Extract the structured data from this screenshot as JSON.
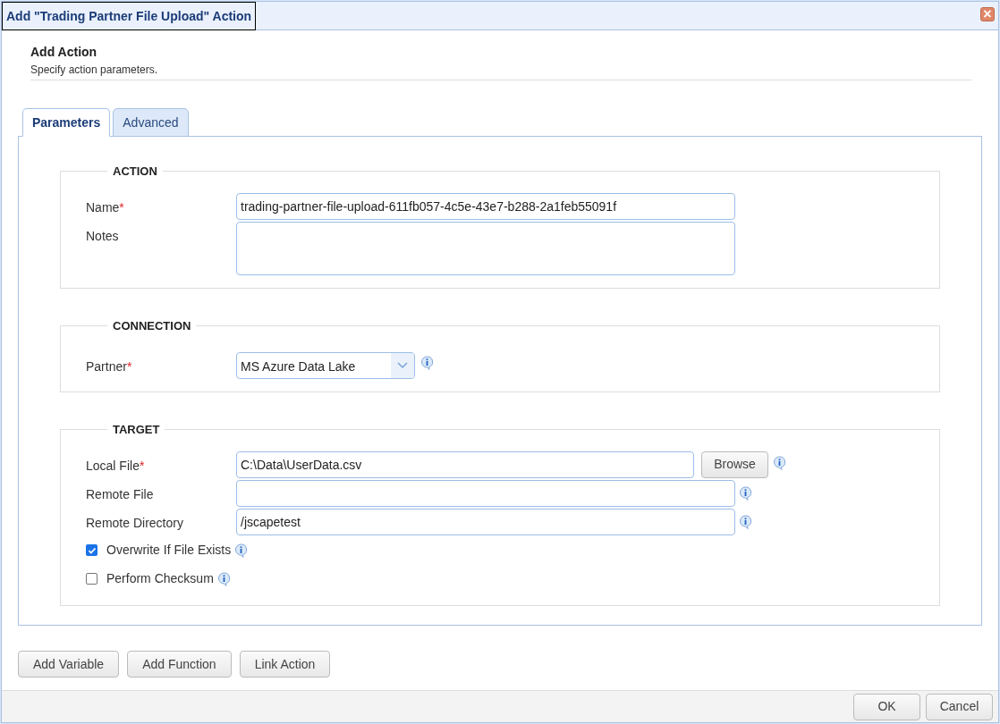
{
  "window": {
    "title": "Add \"Trading Partner File Upload\" Action",
    "close_icon": "×"
  },
  "header": {
    "title": "Add Action",
    "subtitle": "Specify action parameters."
  },
  "tabs": [
    {
      "label": "Parameters",
      "selected": true
    },
    {
      "label": "Advanced",
      "selected": false
    }
  ],
  "sections": [
    {
      "title": "ACTION",
      "fields": [
        {
          "kind": "text",
          "label": "Name",
          "required_mark": "*",
          "value": "trading-partner-file-upload-611fb057-4c5e-43e7-b288-2a1feb55091f",
          "info": false
        },
        {
          "kind": "textarea",
          "label": "Notes",
          "info": false
        }
      ]
    },
    {
      "title": "CONNECTION",
      "fields": [
        {
          "kind": "select",
          "label": "Partner",
          "required_mark": "*",
          "value": "MS Azure Data Lake",
          "info": true
        }
      ]
    },
    {
      "title": "TARGET",
      "fields": [
        {
          "kind": "file",
          "label": "Local File",
          "required_mark": "*",
          "value": "C:\\Data\\UserData.csv",
          "button": "Browse",
          "info": true
        },
        {
          "kind": "text",
          "label": "Remote File",
          "info": true
        },
        {
          "kind": "text",
          "label": "Remote Directory",
          "value": "/jscapetest",
          "info": true
        },
        {
          "kind": "checkbox",
          "label": "Overwrite If File Exists",
          "checked": true,
          "info": true
        },
        {
          "kind": "checkbox",
          "label": "Perform Checksum",
          "checked": false,
          "info": true
        }
      ]
    }
  ],
  "tool_buttons": [
    "Add Variable",
    "Add Function",
    "Link Action"
  ],
  "footer_buttons": [
    "OK",
    "Cancel"
  ]
}
